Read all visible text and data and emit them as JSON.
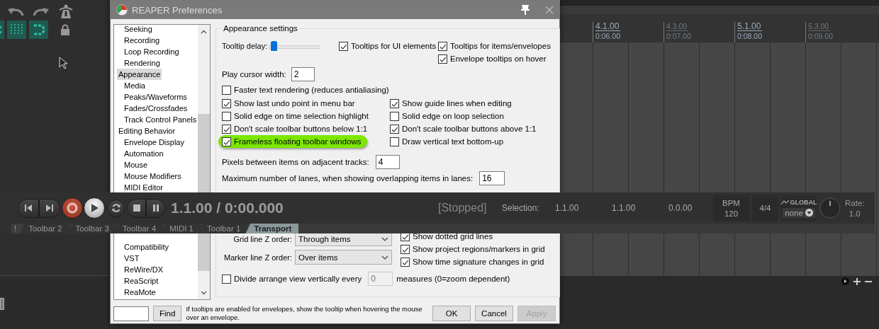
{
  "main_toolbar": {
    "toggles": [
      {
        "kind": "dots",
        "on": true
      },
      {
        "kind": "grid",
        "on": true
      },
      {
        "kind": "snap",
        "on": true
      },
      {
        "kind": "lock",
        "on": false
      }
    ]
  },
  "ruler": {
    "marks": [
      {
        "bar": "4.1.00",
        "time": "0:06.00",
        "major": true
      },
      {
        "bar": "4.3.00",
        "time": "0:07.00",
        "major": false
      },
      {
        "bar": "5.1.00",
        "time": "0:08.00",
        "major": true
      },
      {
        "bar": "5.3.00",
        "time": "0:09.00",
        "major": false
      }
    ]
  },
  "dialog": {
    "title": "REAPER Preferences",
    "tree": {
      "groups": [
        {
          "children": [
            {
              "label": "Seeking",
              "selected": false
            },
            {
              "label": "Recording",
              "selected": false
            },
            {
              "label": "Loop Recording",
              "selected": false
            },
            {
              "label": "Rendering",
              "selected": false
            }
          ]
        },
        {
          "label": "Appearance",
          "selected": true,
          "children": [
            {
              "label": "Media",
              "selected": false
            },
            {
              "label": "Peaks/Waveforms",
              "selected": false
            },
            {
              "label": "Fades/Crossfades",
              "selected": false
            },
            {
              "label": "Track Control Panels",
              "selected": false
            }
          ]
        },
        {
          "label": "Editing Behavior",
          "selected": false,
          "children": [
            {
              "label": "Envelope Display",
              "selected": false
            },
            {
              "label": "Automation",
              "selected": false
            },
            {
              "label": "Mouse",
              "selected": false
            },
            {
              "label": "Mouse Modifiers",
              "selected": false
            },
            {
              "label": "MIDI Editor",
              "selected": false
            }
          ]
        },
        {
          "children": [
            {
              "label": "Compatibility",
              "selected": false
            },
            {
              "label": "VST",
              "selected": false
            },
            {
              "label": "ReWire/DX",
              "selected": false
            },
            {
              "label": "ReaScript",
              "selected": false
            },
            {
              "label": "ReaMote",
              "selected": false
            }
          ]
        }
      ]
    },
    "settings": {
      "title": "Appearance settings",
      "tooltip_delay": {
        "label": "Tooltip delay:",
        "level": 0.05
      },
      "tooltip_checks": [
        {
          "label": "Tooltips for UI elements",
          "checked": true
        },
        {
          "label": "Tooltips for items/envelopes",
          "checked": true
        },
        {
          "label": "Envelope tooltips on hover",
          "checked": true
        }
      ],
      "play_cursor_width": {
        "label": "Play cursor width:",
        "value": "2"
      },
      "faster_text": {
        "label": "Faster text rendering (reduces antialiasing)",
        "checked": false
      },
      "checks": [
        {
          "label": "Show last undo point in menu bar",
          "checked": true,
          "highlighted": false
        },
        {
          "label": "Show guide lines when editing",
          "checked": true,
          "highlighted": false
        },
        {
          "label": "Solid edge on time selection highlight",
          "checked": false,
          "highlighted": false
        },
        {
          "label": "Solid edge on loop selection",
          "checked": false,
          "highlighted": false
        },
        {
          "label": "Don't scale toolbar buttons below 1:1",
          "checked": true,
          "highlighted": false
        },
        {
          "label": "Don't scale toolbar buttons above 1:1",
          "checked": true,
          "highlighted": false
        },
        {
          "label": "Frameless floating toolbar windows",
          "checked": true,
          "highlighted": true
        },
        {
          "label": "Draw vertical text bottom-up",
          "checked": false,
          "highlighted": false
        }
      ],
      "number_fields": [
        {
          "label": "Pixels between items on adjacent tracks:",
          "value": "4"
        },
        {
          "label": "Maximum number of lanes, when showing overlapping items in lanes:",
          "value": "16"
        }
      ],
      "z_orders": [
        {
          "label": "Grid line Z order:",
          "value": "Through items"
        },
        {
          "label": "Marker line Z order:",
          "value": "Over items"
        }
      ],
      "grid_checks": [
        {
          "label": "Show dotted grid lines",
          "checked": true
        },
        {
          "label": "Show project regions/markers in grid",
          "checked": true
        },
        {
          "label": "Show time signature changes in grid",
          "checked": true
        }
      ],
      "divide": {
        "label": "Divide arrange view vertically every",
        "checked": false,
        "value": "0",
        "disabled": true,
        "suffix": "measures (0=zoom dependent)"
      }
    },
    "footer": {
      "find_button": "Find",
      "hint": "If tooltips are enabled for envelopes, show the tooltip when hovering the mouse over an envelope.",
      "buttons": [
        {
          "label": "OK",
          "disabled": false
        },
        {
          "label": "Cancel",
          "disabled": false
        },
        {
          "label": "Apply",
          "disabled": true
        }
      ]
    }
  },
  "transport": {
    "buttons": [
      {
        "kind": "previous"
      },
      {
        "kind": "next"
      },
      {
        "kind": "record"
      },
      {
        "kind": "play"
      },
      {
        "kind": "repeat"
      },
      {
        "kind": "stop"
      },
      {
        "kind": "pause"
      }
    ],
    "time": "1.1.00 / 0:00.000",
    "status": "[Stopped]",
    "selection_label": "Selection:",
    "selection": [
      "1.1.00",
      "1.1.00",
      "0.0.00"
    ],
    "bpm": {
      "label": "BPM",
      "value": "120"
    },
    "time_signature": "4/4",
    "automation": {
      "label": "GLOBAL",
      "value": "none"
    },
    "rate": {
      "label": "Rate:",
      "value": "1.0"
    },
    "tabs": [
      {
        "label": "!",
        "selected": false
      },
      {
        "label": "Toolbar 2",
        "selected": false
      },
      {
        "label": "Toolbar 3",
        "selected": false
      },
      {
        "label": "Toolbar 4",
        "selected": false
      },
      {
        "label": "MIDI 1",
        "selected": false
      },
      {
        "label": "Toolbar 1",
        "selected": false
      },
      {
        "label": "Transport",
        "selected": true
      }
    ]
  }
}
